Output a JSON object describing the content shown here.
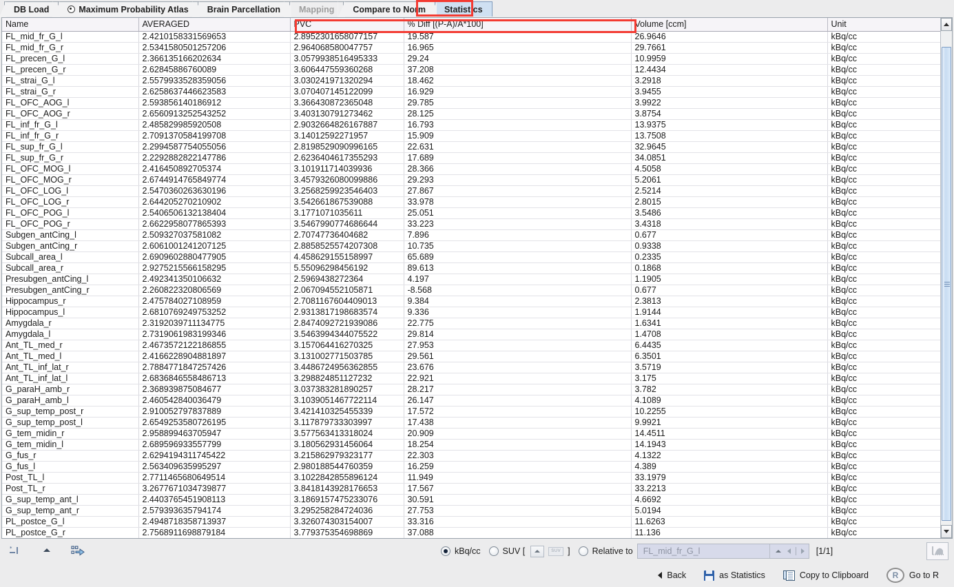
{
  "tabs": [
    {
      "label": "DB Load",
      "state": "normal",
      "icon": null
    },
    {
      "label": "Maximum Probability Atlas",
      "state": "normal",
      "icon": "radio-dot-icon"
    },
    {
      "label": "Brain Parcellation",
      "state": "normal",
      "icon": null
    },
    {
      "label": "Mapping",
      "state": "disabled",
      "icon": null
    },
    {
      "label": "Compare to Norm",
      "state": "normal",
      "icon": null
    },
    {
      "label": "Statistics",
      "state": "selected",
      "icon": null
    }
  ],
  "highlight_color": "#f33a32",
  "table": {
    "columns": [
      "Name",
      "AVERAGED",
      "PVC",
      "% Diff [(P-A)/A*100]",
      "Volume [ccm]",
      "Unit"
    ],
    "rows": [
      [
        "FL_mid_fr_G_l",
        "2.4210158331569653",
        "2.8952301658077157",
        "19.587",
        "26.9646",
        "kBq/cc"
      ],
      [
        "FL_mid_fr_G_r",
        "2.5341580501257206",
        "2.964068580047757",
        "16.965",
        "29.7661",
        "kBq/cc"
      ],
      [
        "FL_precen_G_l",
        "2.366135166202634",
        "3.0579938516495333",
        "29.24",
        "10.9959",
        "kBq/cc"
      ],
      [
        "FL_precen_G_r",
        "2.62845886760089",
        "3.606447559360268",
        "37.208",
        "12.4434",
        "kBq/cc"
      ],
      [
        "FL_strai_G_l",
        "2.5579933528359056",
        "3.030241971320294",
        "18.462",
        "3.2918",
        "kBq/cc"
      ],
      [
        "FL_strai_G_r",
        "2.6258637446623583",
        "3.070407145122099",
        "16.929",
        "3.9455",
        "kBq/cc"
      ],
      [
        "FL_OFC_AOG_l",
        "2.593856140186912",
        "3.366430872365048",
        "29.785",
        "3.9922",
        "kBq/cc"
      ],
      [
        "FL_OFC_AOG_r",
        "2.6560913252543252",
        "3.403130791273462",
        "28.125",
        "3.8754",
        "kBq/cc"
      ],
      [
        "FL_inf_fr_G_l",
        "2.485829985920508",
        "2.9032664826167887",
        "16.793",
        "13.9375",
        "kBq/cc"
      ],
      [
        "FL_inf_fr_G_r",
        "2.7091370584199708",
        "3.14012592271957",
        "15.909",
        "13.7508",
        "kBq/cc"
      ],
      [
        "FL_sup_fr_G_l",
        "2.2994587754055056",
        "2.8198529090996165",
        "22.631",
        "32.9645",
        "kBq/cc"
      ],
      [
        "FL_sup_fr_G_r",
        "2.2292882822147786",
        "2.6236404617355293",
        "17.689",
        "34.0851",
        "kBq/cc"
      ],
      [
        "FL_OFC_MOG_l",
        "2.416450892705374",
        "3.101911714039936",
        "28.366",
        "4.5058",
        "kBq/cc"
      ],
      [
        "FL_OFC_MOG_r",
        "2.6744914765849774",
        "3.4579326080099886",
        "29.293",
        "5.2061",
        "kBq/cc"
      ],
      [
        "FL_OFC_LOG_l",
        "2.5470360263630196",
        "3.2568259923546403",
        "27.867",
        "2.5214",
        "kBq/cc"
      ],
      [
        "FL_OFC_LOG_r",
        "2.644205270210902",
        "3.542661867539088",
        "33.978",
        "2.8015",
        "kBq/cc"
      ],
      [
        "FL_OFC_POG_l",
        "2.5406506132138404",
        "3.1771071035611",
        "25.051",
        "3.5486",
        "kBq/cc"
      ],
      [
        "FL_OFC_POG_r",
        "2.6622958077865393",
        "3.5467990774686644",
        "33.223",
        "3.4318",
        "kBq/cc"
      ],
      [
        "Subgen_antCing_l",
        "2.509327037581082",
        "2.70747736404682",
        "7.896",
        "0.677",
        "kBq/cc"
      ],
      [
        "Subgen_antCing_r",
        "2.6061001241207125",
        "2.8858525574207308",
        "10.735",
        "0.9338",
        "kBq/cc"
      ],
      [
        "Subcall_area_l",
        "2.6909602880477905",
        "4.458629155158997",
        "65.689",
        "0.2335",
        "kBq/cc"
      ],
      [
        "Subcall_area_r",
        "2.9275215566158295",
        "5.55096298456192",
        "89.613",
        "0.1868",
        "kBq/cc"
      ],
      [
        "Presubgen_antCing_l",
        "2.492341350106632",
        "2.5969438272364",
        "4.197",
        "1.1905",
        "kBq/cc"
      ],
      [
        "Presubgen_antCing_r",
        "2.260822320806569",
        "2.067094552105871",
        "-8.568",
        "0.677",
        "kBq/cc"
      ],
      [
        "Hippocampus_r",
        "2.475784027108959",
        "2.7081167604409013",
        "9.384",
        "2.3813",
        "kBq/cc"
      ],
      [
        "Hippocampus_l",
        "2.6810769249753252",
        "2.9313817198683574",
        "9.336",
        "1.9144",
        "kBq/cc"
      ],
      [
        "Amygdala_r",
        "2.3192039711134775",
        "2.8474092721939086",
        "22.775",
        "1.6341",
        "kBq/cc"
      ],
      [
        "Amygdala_l",
        "2.7319061983199346",
        "3.5463994344075522",
        "29.814",
        "1.4708",
        "kBq/cc"
      ],
      [
        "Ant_TL_med_r",
        "2.4673572122186855",
        "3.157064416270325",
        "27.953",
        "6.4435",
        "kBq/cc"
      ],
      [
        "Ant_TL_med_l",
        "2.4166228904881897",
        "3.131002771503785",
        "29.561",
        "6.3501",
        "kBq/cc"
      ],
      [
        "Ant_TL_inf_lat_r",
        "2.7884771847257426",
        "3.4486724956362855",
        "23.676",
        "3.5719",
        "kBq/cc"
      ],
      [
        "Ant_TL_inf_lat_l",
        "2.6836846558486713",
        "3.298824851127232",
        "22.921",
        "3.175",
        "kBq/cc"
      ],
      [
        "G_paraH_amb_r",
        "2.368939875084677",
        "3.037383281890257",
        "28.217",
        "3.782",
        "kBq/cc"
      ],
      [
        "G_paraH_amb_l",
        "2.460542840036479",
        "3.1039051467722114",
        "26.147",
        "4.1089",
        "kBq/cc"
      ],
      [
        "G_sup_temp_post_r",
        "2.910052797837889",
        "3.421410325455339",
        "17.572",
        "10.2255",
        "kBq/cc"
      ],
      [
        "G_sup_temp_post_l",
        "2.6549253580726195",
        "3.117879733303997",
        "17.438",
        "9.9921",
        "kBq/cc"
      ],
      [
        "G_tem_midin_r",
        "2.958899463705947",
        "3.577563413318024",
        "20.909",
        "14.4511",
        "kBq/cc"
      ],
      [
        "G_tem_midin_l",
        "2.689596933557799",
        "3.180562931456064",
        "18.254",
        "14.1943",
        "kBq/cc"
      ],
      [
        "G_fus_r",
        "2.6294194311745422",
        "3.215862979323177",
        "22.303",
        "4.1322",
        "kBq/cc"
      ],
      [
        "G_fus_l",
        "2.563409635995297",
        "2.980188544760359",
        "16.259",
        "4.389",
        "kBq/cc"
      ],
      [
        "Post_TL_l",
        "2.7711465680649514",
        "3.1022842855896124",
        "11.949",
        "33.1979",
        "kBq/cc"
      ],
      [
        "Post_TL_r",
        "3.2677671034739877",
        "3.8418143928176653",
        "17.567",
        "33.2213",
        "kBq/cc"
      ],
      [
        "G_sup_temp_ant_l",
        "2.4403765451908113",
        "3.1869157475233076",
        "30.591",
        "4.6692",
        "kBq/cc"
      ],
      [
        "G_sup_temp_ant_r",
        "2.579393635794174",
        "3.295258284724036",
        "27.753",
        "5.0194",
        "kBq/cc"
      ],
      [
        "PL_postce_G_l",
        "2.4948718358713937",
        "3.326074303154007",
        "33.316",
        "11.6263",
        "kBq/cc"
      ],
      [
        "PL_postce_G_r",
        "2.7568911698879184",
        "3.779375354698869",
        "37.088",
        "11.136",
        "kBq/cc"
      ]
    ]
  },
  "toolbar": {
    "left_icons": [
      {
        "name": "new-text-icon",
        "glyph": "*_|"
      },
      {
        "name": "collapse-icon",
        "glyph": "▲"
      },
      {
        "name": "export-arrow-icon",
        "glyph": "⇨"
      }
    ],
    "units": {
      "kbqcc_label": "kBq/cc",
      "kbqcc_selected": true,
      "suv_label": "SUV [",
      "suv_selected": false,
      "suv_close": "]",
      "suv_chip": "SUV"
    },
    "relative": {
      "label": "Relative to",
      "value": "FL_mid_fr_G_l",
      "placeholder": "FL_mid_fr_G_l",
      "selected": false
    },
    "page_indicator": "[1/1]",
    "chart_button": "histogram-icon"
  },
  "footer": {
    "back": "Back",
    "save_as_statistics": "as Statistics",
    "copy_to_clipboard": "Copy to Clipboard",
    "go_to_r": "Go to R",
    "r_logo": "R"
  }
}
